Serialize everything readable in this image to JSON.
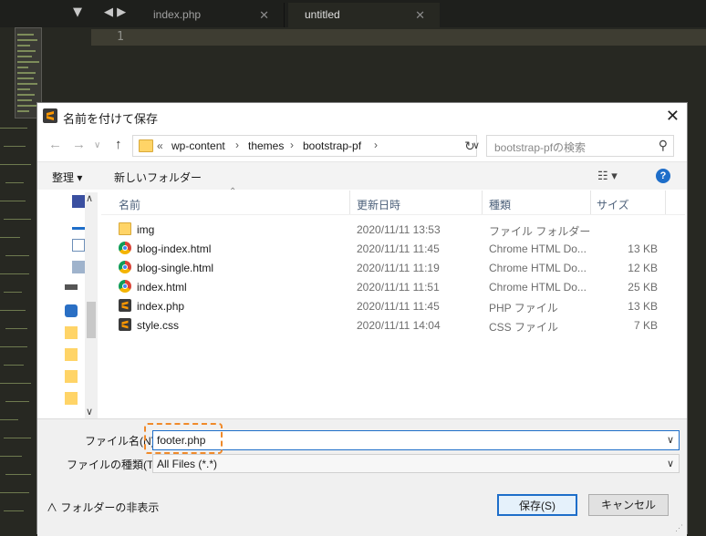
{
  "editor": {
    "tabs": [
      {
        "label": "index.php",
        "active": false
      },
      {
        "label": "untitled",
        "active": true
      }
    ],
    "line_number": "1"
  },
  "dialog": {
    "title": "名前を付けて保存",
    "breadcrumbs": [
      "«",
      "wp-content",
      "themes",
      "bootstrap-pf"
    ],
    "search_placeholder": "bootstrap-pfの検索",
    "toolbar": {
      "organize": "整理 ▾",
      "new_folder": "新しいフォルダー"
    },
    "columns": {
      "name": "名前",
      "date": "更新日時",
      "type": "種類",
      "size": "サイズ"
    },
    "files": [
      {
        "icon": "folder-icon",
        "name": "img",
        "date": "2020/11/11 13:53",
        "type": "ファイル フォルダー",
        "size": ""
      },
      {
        "icon": "chrome-icon",
        "name": "blog-index.html",
        "date": "2020/11/11 11:45",
        "type": "Chrome HTML Do...",
        "size": "13 KB"
      },
      {
        "icon": "chrome-icon",
        "name": "blog-single.html",
        "date": "2020/11/11 11:19",
        "type": "Chrome HTML Do...",
        "size": "12 KB"
      },
      {
        "icon": "chrome-icon",
        "name": "index.html",
        "date": "2020/11/11 11:51",
        "type": "Chrome HTML Do...",
        "size": "25 KB"
      },
      {
        "icon": "sublime-icon",
        "name": "index.php",
        "date": "2020/11/11 11:45",
        "type": "PHP ファイル",
        "size": "13 KB"
      },
      {
        "icon": "sublime-icon",
        "name": "style.css",
        "date": "2020/11/11 14:04",
        "type": "CSS ファイル",
        "size": "7 KB"
      }
    ],
    "filename_label": "ファイル名(N):",
    "filename_value": "footer.php",
    "filetype_label": "ファイルの種類(T):",
    "filetype_value": "All Files (*.*)",
    "hide_folders": "フォルダーの非表示",
    "save_button": "保存(S)",
    "cancel_button": "キャンセル",
    "colors": {
      "accent": "#1e6ec9",
      "highlight": "#f08a2a"
    }
  }
}
